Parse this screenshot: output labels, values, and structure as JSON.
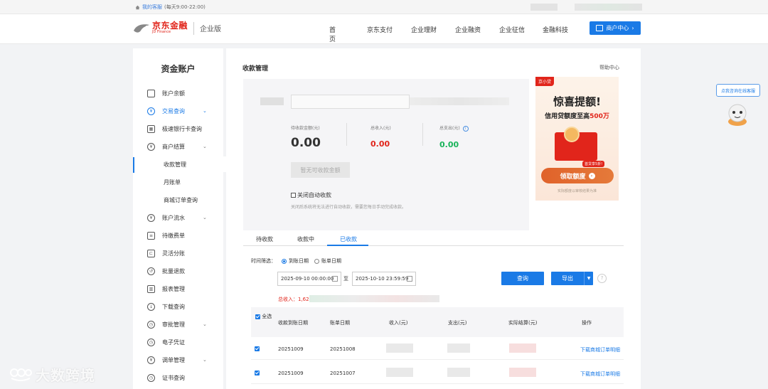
{
  "topbar": {
    "service_link": "我的客服",
    "service_hours": "(每天9:00-22:00)"
  },
  "header": {
    "logo_cn": "京东金融",
    "logo_en": "JD Finance",
    "edition": "企业版",
    "nav": [
      "首页",
      "京东支付",
      "企业理财",
      "企业融资",
      "企业征信",
      "金融科技"
    ],
    "user_center": "商户中心"
  },
  "sidebar": {
    "title": "资金账户",
    "items": [
      {
        "label": "账户余额",
        "icon": "wallet-icon"
      },
      {
        "label": "交易查询",
        "icon": "yuan-icon",
        "chevron": "⌄"
      },
      {
        "label": "极速银行卡查询",
        "icon": "card-grid-icon"
      },
      {
        "label": "商户结算",
        "icon": "yuan-icon",
        "chevron": "⌄"
      },
      {
        "label": "收款管理"
      },
      {
        "label": "月账单"
      },
      {
        "label": "商城订单查询"
      },
      {
        "label": "账户流水",
        "icon": "yuan-icon",
        "chevron": "⌄"
      },
      {
        "label": "待缴费单",
        "icon": "bill-icon"
      },
      {
        "label": "灵活分账",
        "icon": "split-icon"
      },
      {
        "label": "批量退款",
        "icon": "refund-icon"
      },
      {
        "label": "报表管理",
        "icon": "chart-icon"
      },
      {
        "label": "下载查询",
        "icon": "download-icon"
      },
      {
        "label": "审批管理",
        "icon": "clock-icon",
        "chevron": "⌄"
      },
      {
        "label": "电子凭证",
        "icon": "clock-icon"
      },
      {
        "label": "调单管理",
        "icon": "yuan-icon",
        "chevron": "⌄"
      },
      {
        "label": "证书查询",
        "icon": "clock-icon"
      }
    ]
  },
  "main": {
    "title": "收款管理",
    "help": "帮助中心",
    "kpis": [
      {
        "label": "待收款金额(元)",
        "value": "0.00"
      },
      {
        "label": "总收入(元)",
        "value": "0.00"
      },
      {
        "label": "总支出(元)",
        "value": "0.00",
        "info": "i"
      }
    ],
    "no_collect_btn": "暂无可收款金额",
    "auto_collect_label": "关闭自动收款",
    "auto_collect_note": "关闭后系统将无法进行自动收款，需要您每日手动完成收款。",
    "tabs": [
      "待收款",
      "收款中",
      "已收款"
    ],
    "filter": {
      "label": "时间筛选：",
      "options": [
        "到账日期",
        "账单日期"
      ],
      "start": "2025-09-10 00:00:00",
      "sep": "至",
      "end": "2025-10-10 23:59:59",
      "query_btn": "查询",
      "export_btn": "导出",
      "help": "?"
    },
    "total_label": "总收入：1,624",
    "table": {
      "headers": [
        "全选",
        "收款到账日期",
        "账单日期",
        "收入(元)",
        "支出(元)",
        "实际结算(元)",
        "操作"
      ],
      "rows": [
        {
          "date": "20251009",
          "bill_date": "20251008",
          "action": "下载商城订单明细"
        },
        {
          "date": "20251009",
          "bill_date": "20251007",
          "action": "下载商城订单明细"
        }
      ]
    }
  },
  "ad": {
    "tag": "京小贷",
    "headline": "惊喜提额!",
    "sub_prefix": "信用贷额度至高",
    "sub_hi": "500万",
    "badge": "首贷享5折!",
    "cta": "领取额度",
    "foot": "实际额度以审核结果为准"
  },
  "float": {
    "help": "点我咨询在线客服"
  },
  "watermark": "大数跨境"
}
